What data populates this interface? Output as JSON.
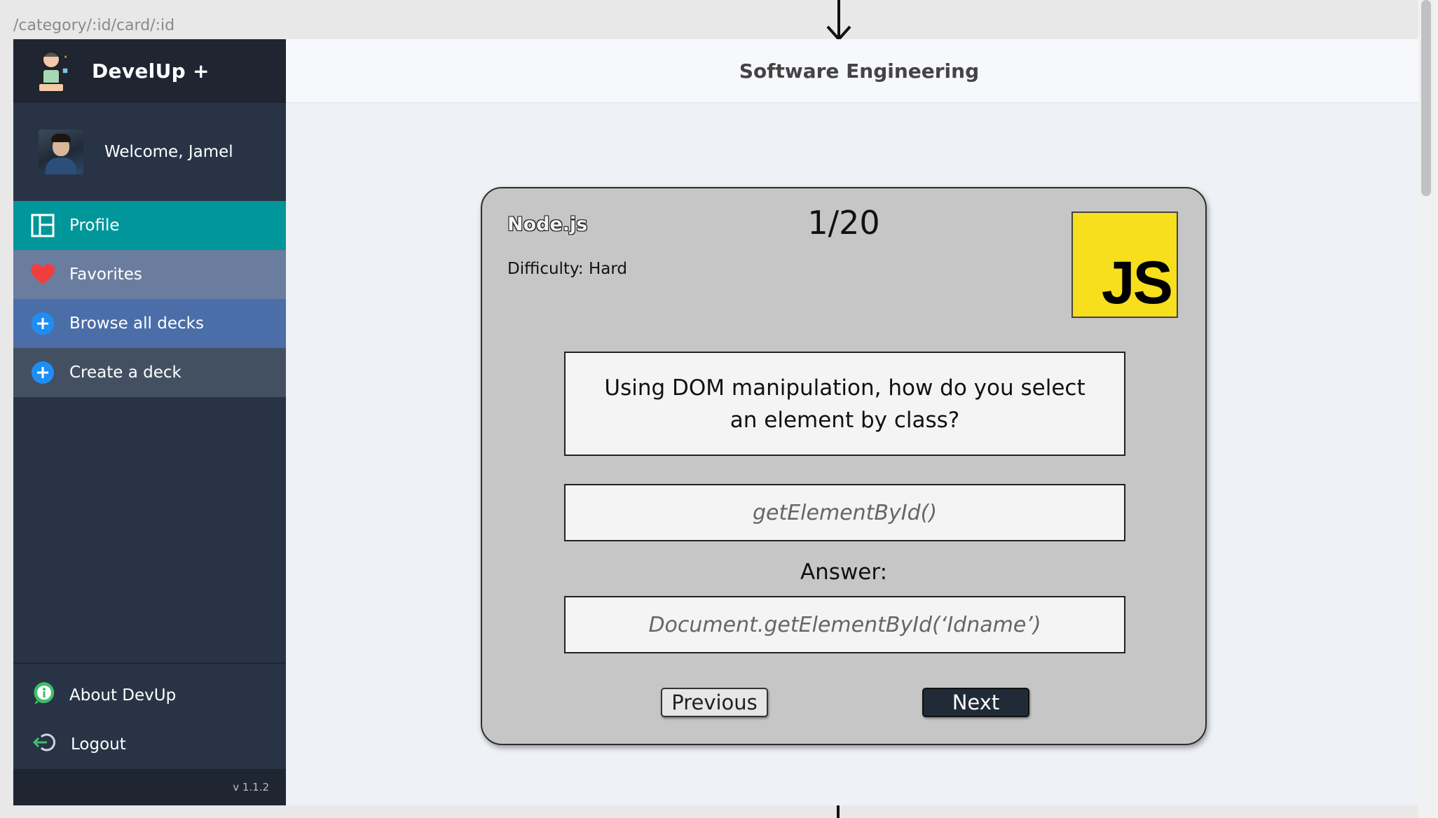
{
  "route": "/category/:id/card/:id",
  "brand": {
    "name": "DevelUp +",
    "logo_icon": "developer-mascot-icon"
  },
  "user": {
    "welcome": "Welcome, Jamel"
  },
  "nav": [
    {
      "label": "Profile",
      "icon": "layout-icon",
      "color": "#00969a"
    },
    {
      "label": "Favorites",
      "icon": "heart-icon",
      "color": "#6b7d9f"
    },
    {
      "label": "Browse all decks",
      "icon": "plus-circle-icon",
      "color": "#4b6ea8"
    },
    {
      "label": "Create a deck",
      "icon": "plus-circle-icon",
      "color": "#435062"
    }
  ],
  "bottom_nav": [
    {
      "label": "About DevUp",
      "icon": "info-icon"
    },
    {
      "label": "Logout",
      "icon": "logout-icon"
    }
  ],
  "version": "v 1.1.2",
  "header": {
    "title": "Software Engineering"
  },
  "card": {
    "topic": "Node.js",
    "difficulty": "Difficulty: Hard",
    "counter": "1/20",
    "badge": "JS",
    "badge_color": "#f7df1e",
    "question": "Using DOM manipulation, how do you select an element by class?",
    "guess_placeholder": "getElementById()",
    "answer_label": "Answer:",
    "answer": "Document.getElementById(‘Idname’)"
  },
  "buttons": {
    "previous": "Previous",
    "next": "Next"
  }
}
